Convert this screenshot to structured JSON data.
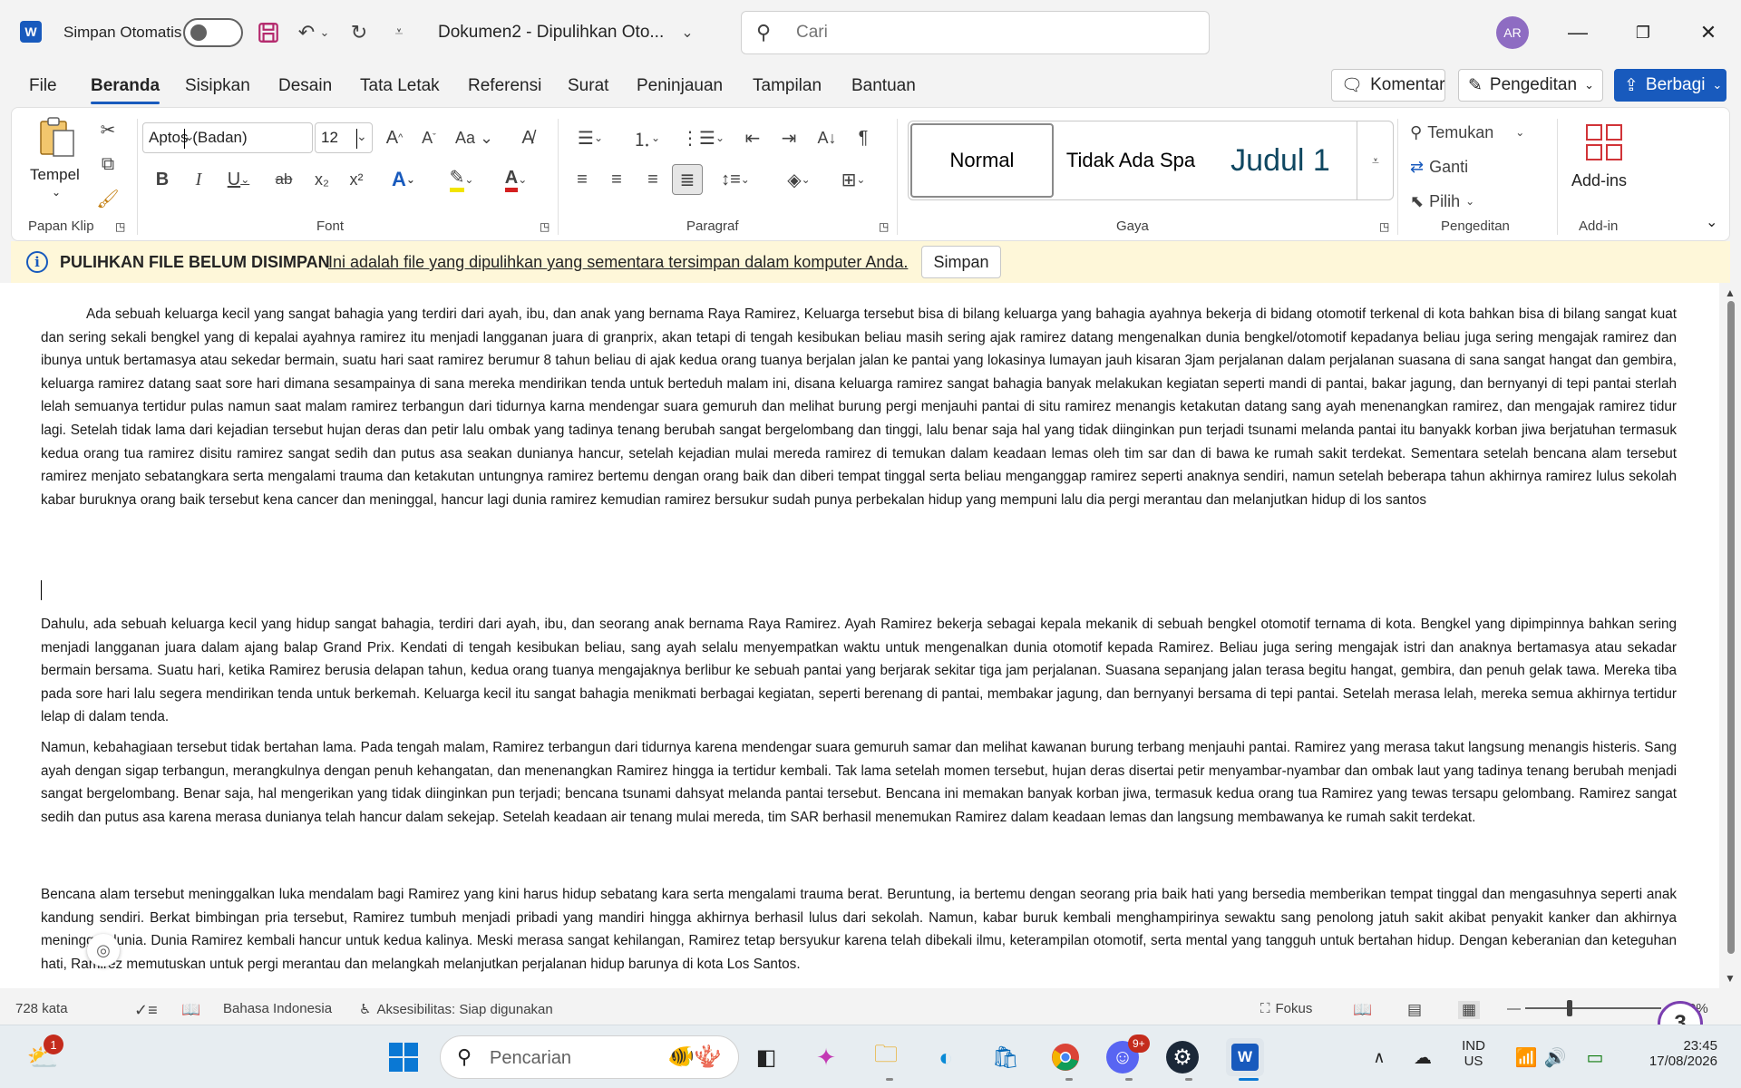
{
  "titlebar": {
    "autosave_label": "Simpan Otomatis",
    "doc_title": "Dokumen2  -  Dipulihkan Oto...",
    "search_placeholder": "Cari",
    "avatar_initials": "AR",
    "app_letter": "W"
  },
  "tabs": [
    "File",
    "Beranda",
    "Sisipkan",
    "Desain",
    "Tata Letak",
    "Referensi",
    "Surat",
    "Peninjauan",
    "Tampilan",
    "Bantuan"
  ],
  "header_buttons": {
    "comment": "Komentar",
    "editing": "Pengeditan",
    "share": "Berbagi"
  },
  "ribbon": {
    "clipboard": {
      "paste": "Tempel",
      "label": "Papan Klip"
    },
    "font": {
      "name": "Aptos (Badan)",
      "size": "12",
      "label": "Font"
    },
    "paragraph": {
      "label": "Paragraf"
    },
    "styles": {
      "items": [
        "Normal",
        "Tidak Ada Spa",
        "Judul 1"
      ],
      "label": "Gaya"
    },
    "editing": {
      "find": "Temukan",
      "replace": "Ganti",
      "select": "Pilih",
      "label": "Pengeditan"
    },
    "addins": {
      "button": "Add-ins",
      "label": "Add-in"
    }
  },
  "infobar": {
    "title": "PULIHKAN FILE BELUM DISIMPAN",
    "message": "Ini adalah file yang dipulihkan yang sementara tersimpan dalam komputer Anda.",
    "button": "Simpan"
  },
  "document": {
    "p1_a": "Ada sebuah keluarga kecil yang sangat bahagia yang terdiri dari ayah, ibu, dan anak yang bernama Raya Ramirez, Keluarga tersebut bisa di bilang keluarga yang bahagia ayahnya bekerja di bidang otomotif terkenal di kota bahkan bisa di bilang sangat kuat dan sering sekali bengkel yang di kepalai ayahnya ramirez itu menjadi langganan juara di granprix, akan tetapi di tengah kesibukan beliau masih sering ajak ramirez datang mengenalkan dunia bengkel/otomotif kepadanya beliau juga sering mengajak ramirez dan ibunya untuk bertamasya atau sekedar bermain, suatu hari saat ramirez berumur 8 tahun beliau di ajak kedua orang tuanya berjalan jalan ke pantai yang lokasinya lumayan jauh kisaran 3jam perjalanan dalam perjalanan suasana di sana sangat hangat dan gembira, keluarga ramirez datang saat sore hari dimana sesampainya di sana mereka mendirikan tenda untuk berteduh malam ini, disana keluarga ramirez sangat bahagia banyak melakukan kegiatan seperti mandi di pantai, bakar jagung, dan bernyanyi di tepi pantai sterlah lelah semuanya tertidur pulas namun saat malam ramirez terbangun dari tidurnya karna mendengar suara gemuruh dan melihat burung pergi menjauhi pantai di situ ramirez menangis ketakutan datang sang ayah menenangkan ramirez, dan mengajak ramirez tidur lagi. ",
    "p1_b": "Setelah tidak lama dari kejadian tersebut hujan deras dan petir lalu ombak yang tadinya tenang berubah sangat bergelombang dan tinggi, lalu benar saja hal yang tidak diinginkan pun terjadi tsunami melanda pantai itu banyakk korban jiwa berjatuhan termasuk kedua orang tua ramirez disitu ramirez sangat sedih dan putus asa seakan dunianya hancur, setelah kejadian mulai mereda ramirez di temukan dalam keadaan lemas oleh tim sar dan di bawa ke rumah sakit terdekat. Sementara setelah bencana alam tersebut ramirez menjato sebatangkara serta mengalami trauma dan ketakutan untungnya ramirez bertemu dengan orang baik dan diberi tempat tinggal serta beliau menganggap ramirez seperti anaknya sendiri, namun setelah beberapa tahun akhirnya ramirez lulus sekolah kabar buruknya orang baik tersebut kena cancer dan meninggal, hancur lagi dunia ramirez kemudian ramirez bersukur sudah punya perbekalan hidup yang mempuni lalu dia pergi merantau dan melanjutkan hidup di los santos",
    "p2": "Dahulu, ada sebuah keluarga kecil yang hidup sangat bahagia, terdiri dari ayah, ibu, dan seorang anak bernama Raya Ramirez. Ayah Ramirez bekerja sebagai kepala mekanik di sebuah bengkel otomotif ternama di kota. Bengkel yang dipimpinnya bahkan sering menjadi langganan juara dalam ajang balap Grand Prix. Kendati di tengah kesibukan beliau, sang ayah selalu menyempatkan waktu untuk mengenalkan dunia otomotif kepada Ramirez. Beliau juga sering mengajak istri dan anaknya bertamasya atau sekadar bermain bersama. Suatu hari, ketika Ramirez berusia delapan tahun, kedua orang tuanya mengajaknya berlibur ke sebuah pantai yang berjarak sekitar tiga jam perjalanan. Suasana sepanjang jalan terasa begitu hangat, gembira, dan penuh gelak tawa. Mereka tiba pada sore hari lalu segera mendirikan tenda untuk berkemah. Keluarga kecil itu sangat bahagia menikmati berbagai kegiatan, seperti berenang di pantai, membakar jagung, dan bernyanyi bersama di tepi pantai. Setelah merasa lelah, mereka semua akhirnya tertidur lelap di dalam tenda.",
    "p3": "Namun, kebahagiaan tersebut tidak bertahan lama. Pada tengah malam, Ramirez terbangun dari tidurnya karena mendengar suara gemuruh samar dan melihat kawanan burung terbang menjauhi pantai. Ramirez yang merasa takut langsung menangis histeris. Sang ayah dengan sigap terbangun, merangkulnya dengan penuh kehangatan, dan menenangkan Ramirez hingga ia tertidur kembali. Tak lama setelah momen tersebut, hujan deras disertai petir menyambar-nyambar dan ombak laut yang tadinya tenang berubah menjadi sangat bergelombang. Benar saja, hal mengerikan yang tidak diinginkan pun terjadi; bencana tsunami dahsyat melanda pantai tersebut. Bencana ini memakan banyak korban jiwa, termasuk kedua orang tua Ramirez yang tewas tersapu gelombang. Ramirez sangat sedih dan putus asa karena merasa dunianya telah hancur dalam sekejap. Setelah keadaan air tenang mulai mereda, tim SAR berhasil menemukan Ramirez dalam keadaan lemas dan langsung membawanya ke rumah sakit terdekat.",
    "p4": "Bencana alam tersebut meninggalkan luka mendalam bagi Ramirez yang kini harus hidup sebatang kara serta mengalami trauma berat. Beruntung, ia bertemu dengan seorang pria baik hati yang bersedia memberikan tempat tinggal dan mengasuhnya seperti anak kandung sendiri. Berkat bimbingan pria tersebut, Ramirez tumbuh menjadi pribadi yang mandiri hingga akhirnya berhasil lulus dari sekolah. Namun, kabar buruk kembali menghampirinya sewaktu sang penolong jatuh sakit akibat penyakit kanker dan akhirnya meninggal dunia. Dunia Ramirez kembali hancur untuk kedua kalinya. Meski merasa sangat kehilangan, Ramirez tetap bersyukur karena telah dibekali ilmu, keterampilan otomotif, serta mental yang tangguh untuk bertahan hidup. Dengan keberanian dan keteguhan hati, Ramirez memutuskan untuk pergi merantau dan melangkah melanjutkan perjalanan hidup barunya di kota Los Santos."
  },
  "statusbar": {
    "word_count": "728 kata",
    "language": "Bahasa Indonesia",
    "accessibility": "Aksesibilitas: Siap digunakan",
    "focus": "Fokus",
    "zoom": "0%",
    "badge": "3"
  },
  "taskbar": {
    "search_placeholder": "Pencarian",
    "weather_badge": "1",
    "discord_badge": "9+",
    "lang_line1": "IND",
    "lang_line2": "US",
    "time": "23:45",
    "date": "17/08/2026"
  },
  "colors": {
    "accent": "#185abd",
    "infobar_bg": "#fef7d9",
    "spell_underline": "#e0606d",
    "grammar_underline": "#5b8fd8"
  }
}
